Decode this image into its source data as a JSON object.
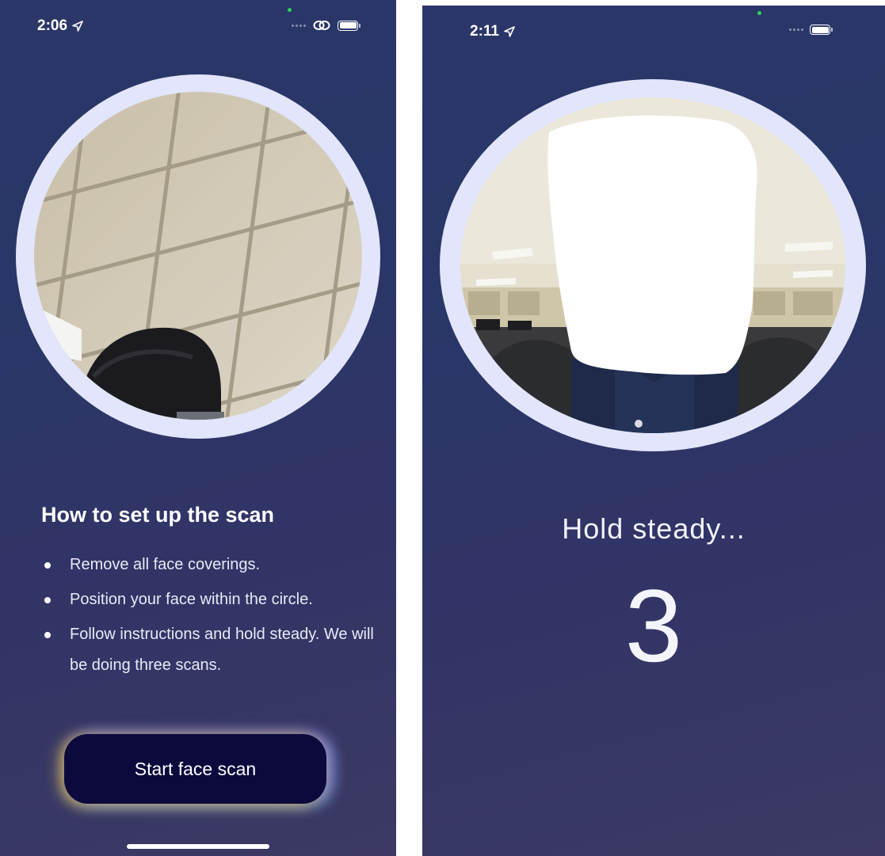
{
  "left_screen": {
    "status_bar": {
      "time": "2:06"
    },
    "setup": {
      "title": "How to set up the scan",
      "steps": [
        "Remove all face coverings.",
        "Position your face within the circle.",
        "Follow instructions and hold steady. We will be doing three scans."
      ]
    },
    "start_button_label": "Start face scan"
  },
  "right_screen": {
    "status_bar": {
      "time": "2:11"
    },
    "status_text": "Hold steady...",
    "countdown": "3"
  },
  "colors": {
    "background": "#2c3668",
    "ring": "#e2e5fb",
    "button": "#0c0a3c",
    "status_dot": "#2fd158"
  }
}
